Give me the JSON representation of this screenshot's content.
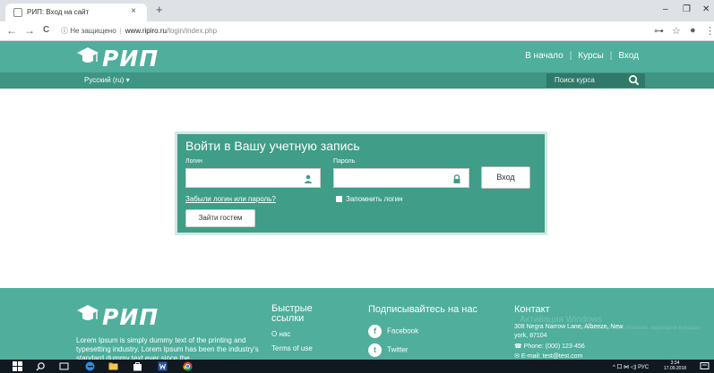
{
  "browser": {
    "tab_title": "РИП: Вход на сайт",
    "tab_close": "×",
    "new_tab": "+",
    "window_controls": [
      "–",
      "❐",
      "✕"
    ],
    "url_security": "ⓘ Не защищено",
    "url_host": "www.ripiro.ru",
    "url_path": "/login/index.php",
    "back": "←",
    "forward": "→",
    "reload": "C",
    "ext_key": "⊶",
    "star": "☆",
    "account": "●",
    "menu": "⋮"
  },
  "header": {
    "logo_text": "РИП",
    "nav": [
      "В начало",
      "Курсы",
      "Вход"
    ],
    "lang": "Русский (ru) ▾",
    "search_placeholder": "Поиск курса"
  },
  "login": {
    "title": "Войти в Вашу учетную запись",
    "username_label": "Логин",
    "password_label": "Пароль",
    "login_button": "Вход",
    "forgot_link": "Забыли логин или пароль?",
    "remember_label": "Запомнить логин",
    "guest_button": "Зайти гостем"
  },
  "footer": {
    "logo_text": "РИП",
    "lorem": "Lorem Ipsum is simply dummy text of the printing and typesetting industry. Lorem Ipsum has been the industry's standard dummy text ever since the",
    "quick_links_title_1": "Быстрые",
    "quick_links_title_2": "ссылки",
    "quick_links": [
      "О нас",
      "Terms of use"
    ],
    "subscribe_title": "Подписывайтесь на нас",
    "social": [
      {
        "label": "Facebook",
        "icon": "facebook-icon",
        "glyph": "f"
      },
      {
        "label": "Twitter",
        "icon": "twitter-icon",
        "glyph": "t"
      }
    ],
    "contact_title": "Контакт",
    "address_1": "308 Negra Narrow Lane, Albeeze, New",
    "address_2": "york, 87104",
    "phone": "Phone: (000) 123-456",
    "email": "E-mail: test@test.com",
    "activation_1": "Активация Windows",
    "activation_2": "Чтобы активировать Windows, перейдите в раздел"
  },
  "taskbar": {
    "tray_text": "^ 口 ⋈ ◁) РУС",
    "time": "3:34",
    "date": "17.09.2018"
  },
  "colors": {
    "header_green": "#4fae9c",
    "subbar_green": "#3d9582",
    "panel_green": "#3f9d88"
  }
}
